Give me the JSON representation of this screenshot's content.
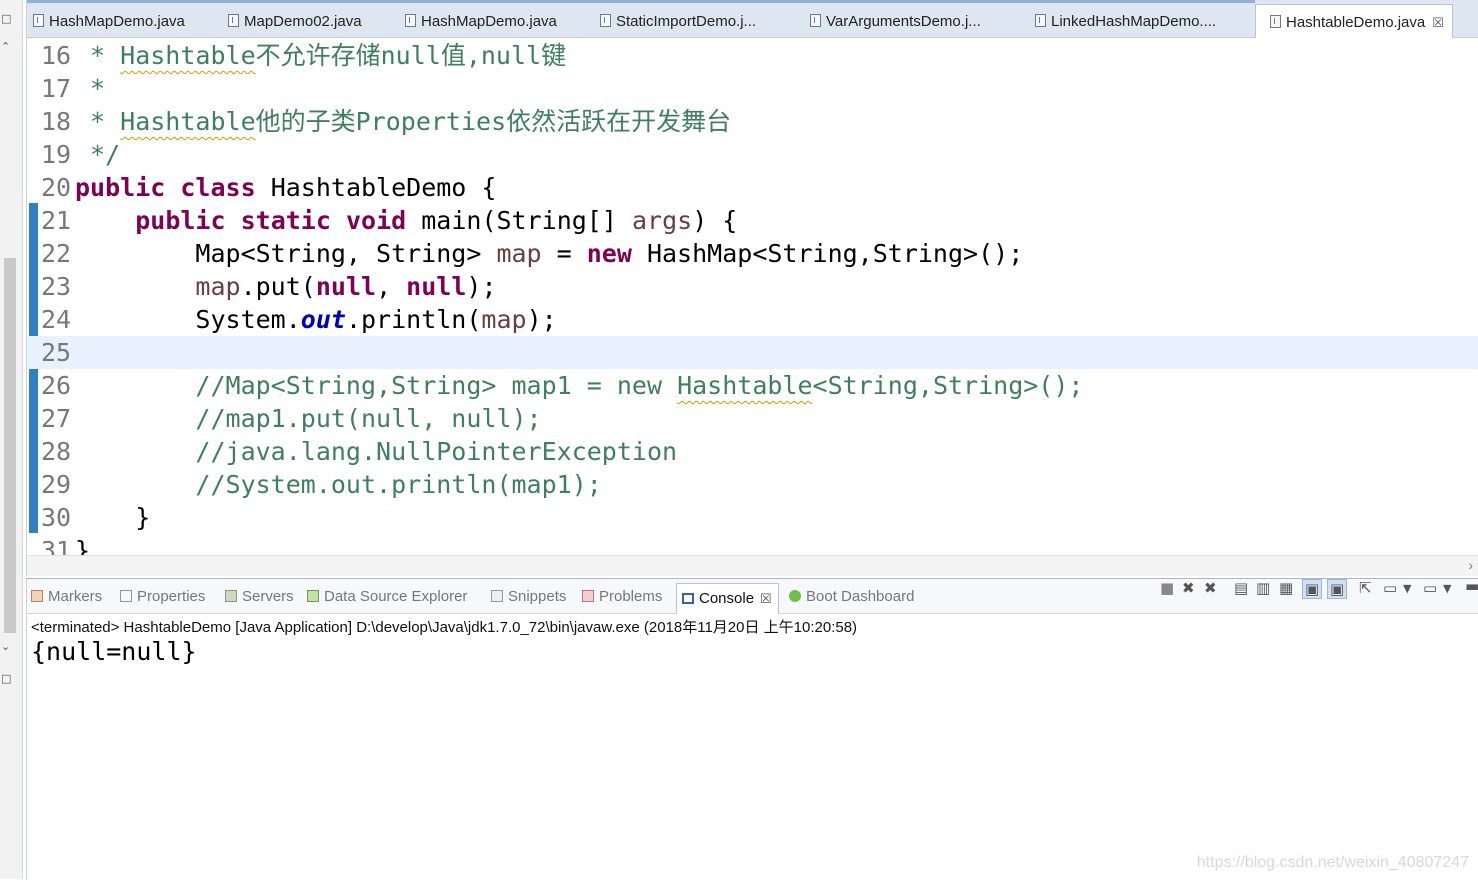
{
  "editor_tabs": [
    {
      "label": "HashMapDemo.java",
      "active": false
    },
    {
      "label": "MapDemo02.java",
      "active": false
    },
    {
      "label": "HashMapDemo.java",
      "active": false
    },
    {
      "label": "StaticImportDemo.j...",
      "active": false
    },
    {
      "label": "VarArgumentsDemo.j...",
      "active": false
    },
    {
      "label": "LinkedHashMapDemo....",
      "active": false
    },
    {
      "label": "HashtableDemo.java",
      "active": true
    }
  ],
  "close_glyph": "☒",
  "code": {
    "lines": [
      {
        "num": "16",
        "text": " * Hashtable不允许存储null值,null键"
      },
      {
        "num": "17",
        "text": " *"
      },
      {
        "num": "18",
        "text": " * Hashtable他的子类Properties依然活跃在开发舞台"
      },
      {
        "num": "19",
        "text": " */"
      },
      {
        "num": "20",
        "text": "public class HashtableDemo {"
      },
      {
        "num": "21",
        "text": "    public static void main(String[] args) {"
      },
      {
        "num": "22",
        "text": "        Map<String, String> map = new HashMap<String,String>();"
      },
      {
        "num": "23",
        "text": "        map.put(null, null);"
      },
      {
        "num": "24",
        "text": "        System.out.println(map);"
      },
      {
        "num": "25",
        "text": ""
      },
      {
        "num": "26",
        "text": "        //Map<String,String> map1 = new Hashtable<String,String>();"
      },
      {
        "num": "27",
        "text": "        //map1.put(null, null);"
      },
      {
        "num": "28",
        "text": "        //java.lang.NullPointerException"
      },
      {
        "num": "29",
        "text": "        //System.out.println(map1);"
      },
      {
        "num": "30",
        "text": "    }"
      },
      {
        "num": "31",
        "text": "}"
      }
    ],
    "current_line": "25"
  },
  "console_tabs": [
    {
      "label": "Markers",
      "icon": "markers-icon",
      "active": false
    },
    {
      "label": "Properties",
      "icon": "properties-icon",
      "active": false
    },
    {
      "label": "Servers",
      "icon": "servers-icon",
      "active": false
    },
    {
      "label": "Data Source Explorer",
      "icon": "data-source-icon",
      "active": false
    },
    {
      "label": "Snippets",
      "icon": "snippets-icon",
      "active": false
    },
    {
      "label": "Problems",
      "icon": "problems-icon",
      "active": false
    },
    {
      "label": "Console",
      "icon": "console-icon",
      "active": true
    },
    {
      "label": "Boot Dashboard",
      "icon": "boot-dashboard-icon",
      "active": false
    }
  ],
  "console": {
    "status": "<terminated> HashtableDemo [Java Application] D:\\develop\\Java\\jdk1.7.0_72\\bin\\javaw.exe (2018年11月20日 上午10:20:58)",
    "output": "{null=null}"
  },
  "watermark": "https://blog.csdn.net/weixin_40807247",
  "colors": {
    "keyword": "#7f0055",
    "comment": "#3f7f5f",
    "variable": "#6a3e3e",
    "field": "#0000c0",
    "current_line": "#e8f2fe",
    "tab_bar": "#dde6f1"
  }
}
